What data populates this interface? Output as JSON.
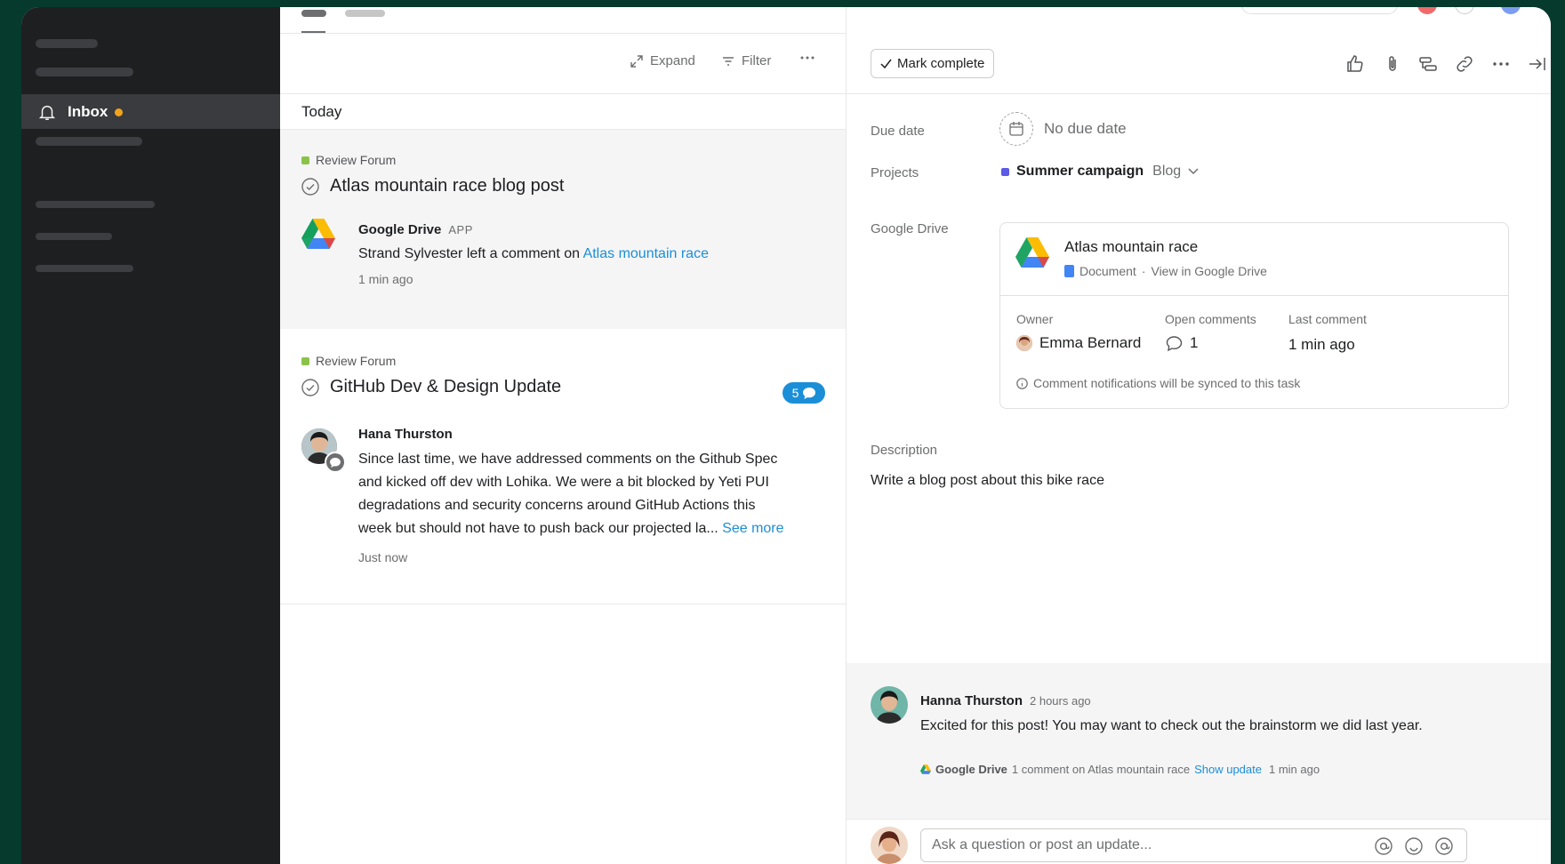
{
  "sidebar": {
    "inbox_label": "Inbox"
  },
  "toolbar": {
    "expand_label": "Expand",
    "filter_label": "Filter"
  },
  "inbox": {
    "section_title": "Today",
    "items": [
      {
        "project": "Review Forum",
        "title": "Atlas mountain race blog post",
        "author": "Google Drive",
        "author_tag": "APP",
        "body_prefix": "Strand Sylvester left a comment on ",
        "body_link": "Atlas mountain race",
        "time": "1 min ago"
      },
      {
        "project": "Review Forum",
        "title": "GitHub Dev & Design Update",
        "comment_count": "5",
        "author": "Hana Thurston",
        "body_lines": [
          "Since last time, we have addressed comments on the Github Spec",
          "and kicked off dev with Lohika. We were a bit blocked by Yeti PUI",
          "degradations and security concerns around GitHub Actions this",
          "week but should not have to push back our projected la..."
        ],
        "see_more": "See more",
        "time": "Just now"
      }
    ]
  },
  "detail": {
    "mark_complete": "Mark complete",
    "due_date_label": "Due date",
    "due_date_value": "No due date",
    "projects_label": "Projects",
    "project_name": "Summer campaign",
    "project_section": "Blog",
    "google_drive_label": "Google Drive",
    "gd_card": {
      "title": "Atlas mountain race",
      "doc_type": "Document",
      "view_link": "View in Google Drive",
      "separator": "·",
      "owner_label": "Owner",
      "owner_value": "Emma Bernard",
      "open_comments_label": "Open comments",
      "open_comments_value": "1",
      "last_comment_label": "Last comment",
      "last_comment_value": "1 min ago",
      "note": "Comment notifications will be synced to this task"
    },
    "description_label": "Description",
    "description_text": "Write a blog post about this bike race"
  },
  "activity": {
    "author": "Hanna Thurston",
    "time": "2 hours ago",
    "body": "Excited for this post! You may want to check out the brainstorm we did last year.",
    "meta_app": "Google Drive",
    "meta_text": "1 comment on Atlas mountain race",
    "meta_link": "Show update",
    "meta_time": "1 min ago"
  },
  "composer": {
    "placeholder": "Ask a question or post an update..."
  },
  "colors": {
    "sidebar_bg": "#1e1f21",
    "link_blue": "#1a8fd8",
    "inbox_dot": "#f1a41b",
    "project_green": "#8bc34a",
    "project_purple": "#5b5be6",
    "background_green": "#053a2c"
  }
}
